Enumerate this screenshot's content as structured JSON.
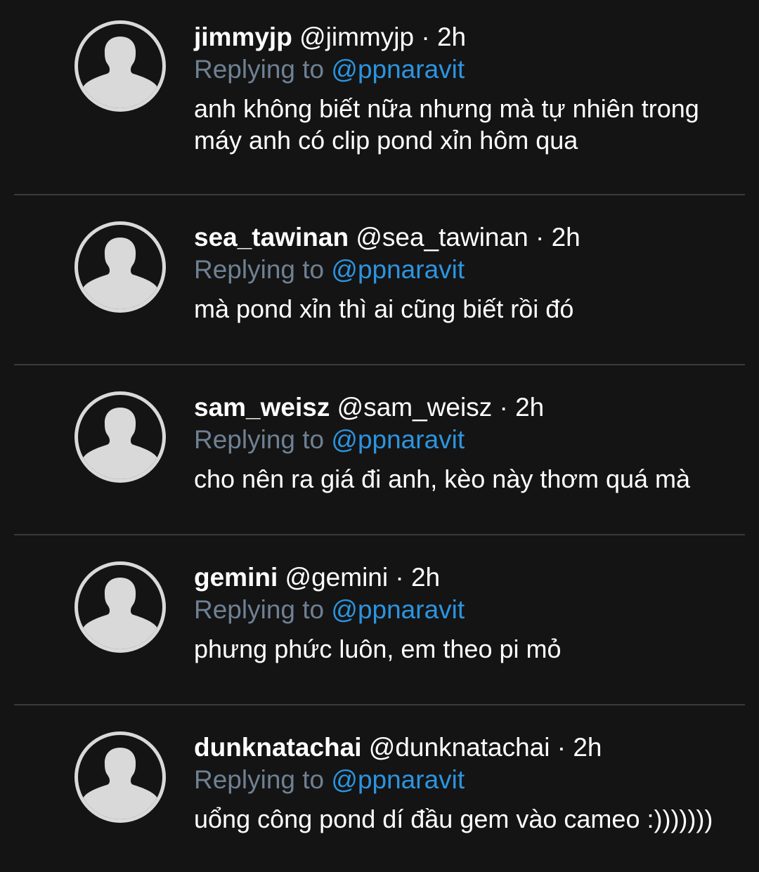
{
  "colors": {
    "background": "#141414",
    "text": "#ffffff",
    "muted": "#6f8193",
    "link": "#2c94e0",
    "divider": "#3a3a3a",
    "avatar": "#d9d9d9"
  },
  "replies": [
    {
      "display_name": "jimmyjp",
      "handle": "@jimmyjp",
      "separator": "·",
      "time": "2h",
      "replying_prefix": "Replying to",
      "replying_to": "@ppnaravit",
      "text": "anh không biết nữa nhưng mà tự nhiên trong máy anh có clip pond xỉn hôm qua",
      "avatar_icon": "default-user-silhouette-icon"
    },
    {
      "display_name": "sea_tawinan",
      "handle": "@sea_tawinan",
      "separator": "·",
      "time": "2h",
      "replying_prefix": "Replying to",
      "replying_to": "@ppnaravit",
      "text": "mà pond xỉn thì ai cũng biết rồi đó",
      "avatar_icon": "default-user-silhouette-icon"
    },
    {
      "display_name": "sam_weisz",
      "handle": "@sam_weisz",
      "separator": "·",
      "time": "2h",
      "replying_prefix": "Replying to",
      "replying_to": "@ppnaravit",
      "text": "cho nên ra giá đi anh, kèo này thơm quá mà",
      "avatar_icon": "default-user-silhouette-icon"
    },
    {
      "display_name": "gemini",
      "handle": "@gemini",
      "separator": "·",
      "time": "2h",
      "replying_prefix": "Replying to",
      "replying_to": "@ppnaravit",
      "text": "phưng phức luôn, em theo pi mỏ",
      "avatar_icon": "default-user-silhouette-icon"
    },
    {
      "display_name": "dunknatachai",
      "handle": "@dunknatachai",
      "separator": "·",
      "time": "2h",
      "replying_prefix": "Replying to",
      "replying_to": "@ppnaravit",
      "text": "uổng công pond dí đầu gem vào cameo :)))))))",
      "avatar_icon": "default-user-silhouette-icon"
    }
  ]
}
